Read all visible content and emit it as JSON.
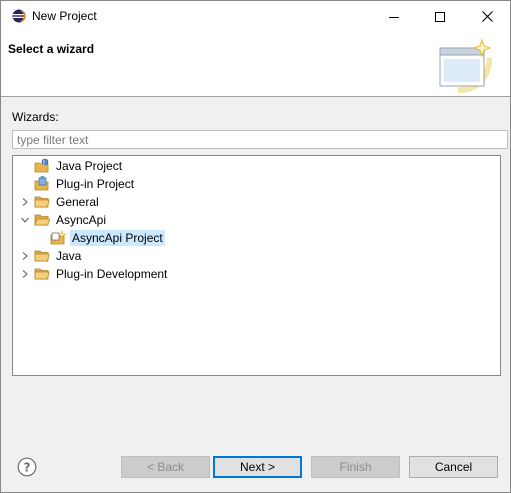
{
  "window": {
    "title": "New Project"
  },
  "banner": {
    "title": "Select a wizard"
  },
  "wizards_label": "Wizards:",
  "filter": {
    "placeholder": "type filter text",
    "value": ""
  },
  "tree": {
    "items": [
      {
        "label": "Java Project",
        "expandable": false,
        "expanded": false,
        "selected": false,
        "icon": "java-project-icon"
      },
      {
        "label": "Plug-in Project",
        "expandable": false,
        "expanded": false,
        "selected": false,
        "icon": "plugin-project-icon"
      },
      {
        "label": "General",
        "expandable": true,
        "expanded": false,
        "selected": false,
        "icon": "folder-icon"
      },
      {
        "label": "AsyncApi",
        "expandable": true,
        "expanded": true,
        "selected": false,
        "icon": "folder-icon"
      },
      {
        "label": "AsyncApi Project",
        "expandable": false,
        "expanded": false,
        "selected": true,
        "icon": "asyncapi-project-icon"
      },
      {
        "label": "Java",
        "expandable": true,
        "expanded": false,
        "selected": false,
        "icon": "folder-icon"
      },
      {
        "label": "Plug-in Development",
        "expandable": true,
        "expanded": false,
        "selected": false,
        "icon": "folder-icon"
      }
    ]
  },
  "buttons": {
    "back": {
      "label": "< Back",
      "enabled": false
    },
    "next": {
      "label": "Next >",
      "enabled": true
    },
    "finish": {
      "label": "Finish",
      "enabled": false
    },
    "cancel": {
      "label": "Cancel",
      "enabled": true
    }
  },
  "colors": {
    "selection": "#cce8ff",
    "folder": "#e8b54a",
    "default_button_border": "#0078d7"
  }
}
